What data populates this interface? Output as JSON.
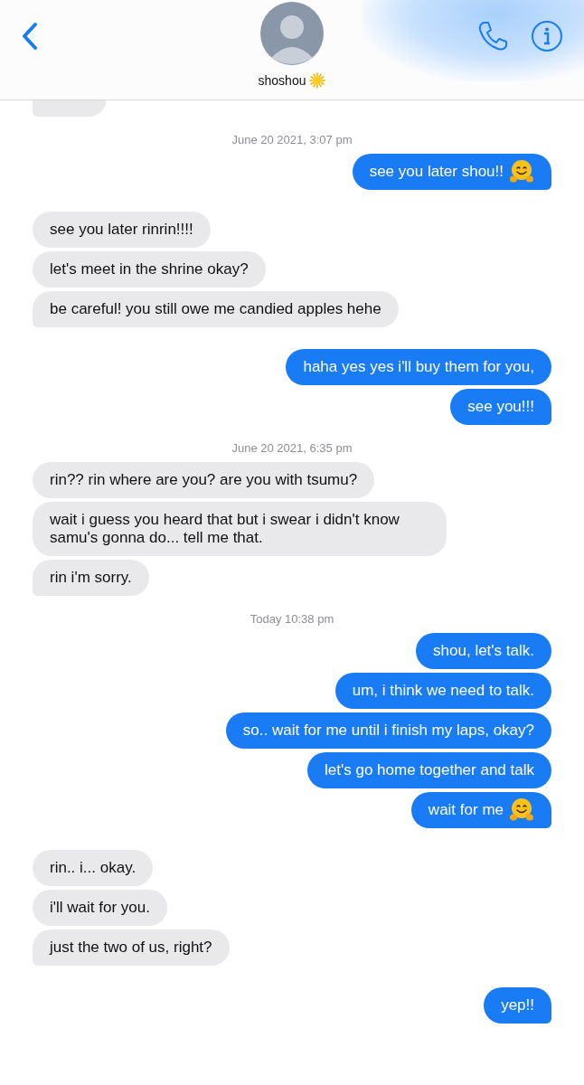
{
  "contact": {
    "name": "shoshou",
    "name_icon": true
  },
  "messages": [
    {
      "kind": "incoming_cut"
    },
    {
      "kind": "timestamp",
      "text": "June 20 2021, 3:07 pm"
    },
    {
      "kind": "outgoing",
      "text": "see you later shou!!",
      "trailing_icon": true
    },
    {
      "kind": "incoming",
      "text": "see you later rinrin!!!!"
    },
    {
      "kind": "incoming",
      "text": "let's meet in the shrine okay?"
    },
    {
      "kind": "incoming",
      "text": "be careful! you still owe me candied apples hehe"
    },
    {
      "kind": "outgoing",
      "text": "haha yes yes i'll buy them for you,"
    },
    {
      "kind": "outgoing",
      "text": "see you!!!"
    },
    {
      "kind": "timestamp",
      "text": "June 20 2021, 6:35 pm"
    },
    {
      "kind": "incoming",
      "text": "rin?? rin where are you? are you with tsumu?"
    },
    {
      "kind": "incoming",
      "text": "wait i guess you heard that but i swear i didn't know samu's gonna do... tell me that."
    },
    {
      "kind": "incoming",
      "text": "rin i'm sorry."
    },
    {
      "kind": "timestamp",
      "text": "Today 10:38 pm"
    },
    {
      "kind": "outgoing",
      "text": "shou, let's talk."
    },
    {
      "kind": "outgoing",
      "text": "um, i think we need to talk."
    },
    {
      "kind": "outgoing",
      "text": "so.. wait for me until i finish my laps, okay?"
    },
    {
      "kind": "outgoing",
      "text": "let's go home together and talk"
    },
    {
      "kind": "outgoing",
      "text": "wait for me",
      "trailing_icon": true
    },
    {
      "kind": "incoming",
      "text": "rin.. i... okay."
    },
    {
      "kind": "incoming",
      "text": "i'll wait for you."
    },
    {
      "kind": "incoming",
      "text": "just the two of us, right?"
    },
    {
      "kind": "outgoing",
      "text": "yep!!"
    }
  ]
}
